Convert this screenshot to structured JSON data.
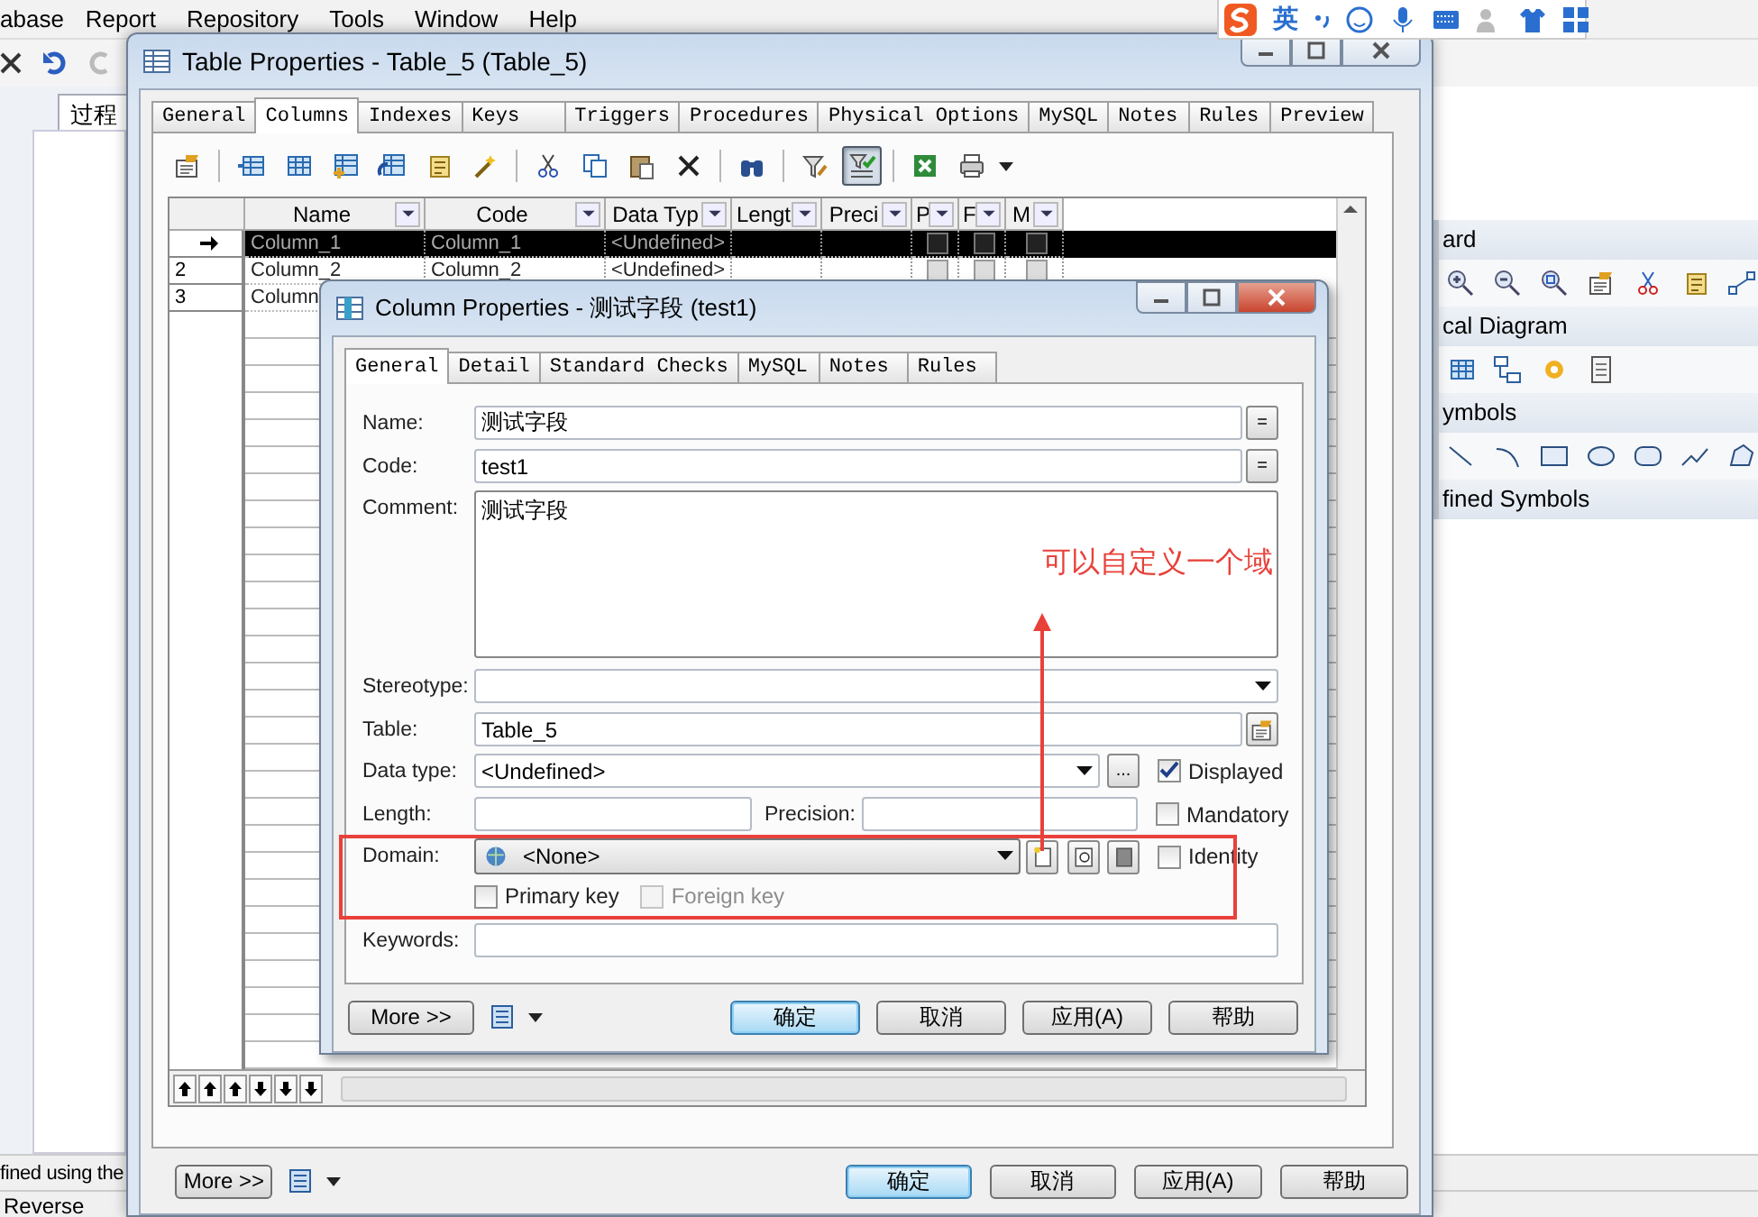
{
  "app": {
    "menu": [
      "abase",
      "Report",
      "Repository",
      "Tools",
      "Window",
      "Help"
    ],
    "left_tab": "过程",
    "status_text": "fined using the",
    "bottom_tab": "Reverse",
    "toolbox": [
      {
        "title": "ard"
      },
      {
        "title": "cal Diagram"
      },
      {
        "title": "ymbols"
      },
      {
        "title": "fined Symbols"
      }
    ]
  },
  "ime_bar": {
    "mode": "英"
  },
  "table_window": {
    "title": "Table Properties - Table_5 (Table_5)",
    "tabs": [
      {
        "label": "General",
        "selected": false
      },
      {
        "label": "Columns",
        "selected": true
      },
      {
        "label": "Indexes",
        "selected": false
      },
      {
        "label": "Keys",
        "selected": false
      },
      {
        "label": "Triggers",
        "selected": false
      },
      {
        "label": "Procedures",
        "selected": false
      },
      {
        "label": "Physical Options",
        "selected": false
      },
      {
        "label": "MySQL",
        "selected": false
      },
      {
        "label": "Notes",
        "selected": false
      },
      {
        "label": "Rules",
        "selected": false
      },
      {
        "label": "Preview",
        "selected": false
      }
    ],
    "toolbar": [
      {
        "kind": "properties",
        "pressed": false
      },
      {
        "kind": "separator"
      },
      {
        "kind": "insert-row",
        "pressed": false
      },
      {
        "kind": "add-row",
        "pressed": false
      },
      {
        "kind": "add-column",
        "pressed": false
      },
      {
        "kind": "replicate",
        "pressed": false
      },
      {
        "kind": "note",
        "pressed": false
      },
      {
        "kind": "wand",
        "pressed": false
      },
      {
        "kind": "separator"
      },
      {
        "kind": "cut",
        "pressed": false
      },
      {
        "kind": "copy",
        "pressed": false
      },
      {
        "kind": "paste",
        "pressed": false
      },
      {
        "kind": "delete",
        "pressed": false
      },
      {
        "kind": "separator"
      },
      {
        "kind": "find",
        "pressed": false
      },
      {
        "kind": "separator"
      },
      {
        "kind": "filter",
        "pressed": false
      },
      {
        "kind": "filter-check",
        "pressed": true
      },
      {
        "kind": "separator"
      },
      {
        "kind": "spreadsheet",
        "pressed": false
      },
      {
        "kind": "print",
        "pressed": false
      }
    ],
    "grid": {
      "columns": [
        "Name",
        "Code",
        "Data Typ",
        "Lengt",
        "Preci",
        "P",
        "F",
        "M"
      ],
      "rows": [
        {
          "selected": true,
          "name": "Column_1",
          "code": "Column_1",
          "data_type": "<Undefined>",
          "primary": false,
          "foreign": false,
          "mandatory": false
        },
        {
          "selected": false,
          "number": "2",
          "name": "Column_2",
          "code": "Column_2",
          "data_type": "<Undefined>",
          "primary": false,
          "foreign": false,
          "mandatory": false
        },
        {
          "selected": false,
          "number": "3",
          "name": "Column"
        }
      ]
    },
    "buttons": [
      {
        "label": "More >>",
        "kind": "more"
      },
      {
        "label": "确定",
        "kind": "default"
      },
      {
        "label": "取消",
        "kind": "normal"
      },
      {
        "label": "应用(A)",
        "kind": "normal"
      },
      {
        "label": "帮助",
        "kind": "normal"
      }
    ]
  },
  "column_dialog": {
    "title": "Column Properties - 测试字段 (test1)",
    "tabs": [
      {
        "label": "General",
        "selected": true
      },
      {
        "label": "Detail",
        "selected": false
      },
      {
        "label": "Standard Checks",
        "selected": false
      },
      {
        "label": "MySQL",
        "selected": false
      },
      {
        "label": "Notes",
        "selected": false
      },
      {
        "label": "Rules",
        "selected": false
      }
    ],
    "fields": {
      "name": {
        "label": "Name:",
        "value": "测试字段",
        "button": "="
      },
      "code": {
        "label": "Code:",
        "value": "test1",
        "button": "="
      },
      "comment": {
        "label": "Comment:",
        "value": "测试字段"
      },
      "stereotype": {
        "label": "Stereotype:"
      },
      "table": {
        "label": "Table:",
        "value": "Table_5"
      },
      "data_type": {
        "label": "Data type:",
        "value": "<Undefined>",
        "button": "..."
      },
      "length": {
        "label": "Length:"
      },
      "precision": {
        "label": "Precision:"
      },
      "domain": {
        "label": "Domain:",
        "value": "<None>"
      },
      "keywords": {
        "label": "Keywords:"
      }
    },
    "checkboxes": {
      "displayed": {
        "label": "Displayed",
        "checked": true,
        "disabled": false
      },
      "mandatory": {
        "label": "Mandatory",
        "checked": false,
        "disabled": false
      },
      "identity": {
        "label": "Identity",
        "checked": false,
        "disabled": false
      },
      "primary_key": {
        "label": "Primary key",
        "checked": false,
        "disabled": false
      },
      "foreign_key": {
        "label": "Foreign key",
        "checked": false,
        "disabled": true
      }
    },
    "buttons": [
      {
        "label": "More >>",
        "kind": "more"
      },
      {
        "label": "确定",
        "kind": "default"
      },
      {
        "label": "取消",
        "kind": "normal"
      },
      {
        "label": "应用(A)",
        "kind": "normal"
      },
      {
        "label": "帮助",
        "kind": "normal"
      }
    ]
  },
  "annotation": {
    "text": "可以自定义一个域"
  }
}
